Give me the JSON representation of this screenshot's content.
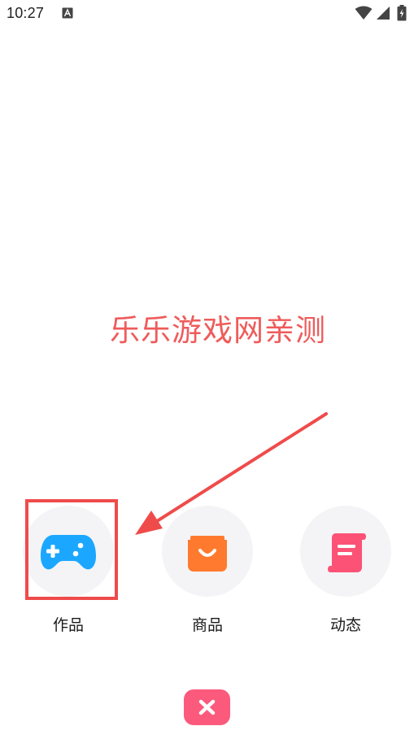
{
  "status_bar": {
    "time": "10:27",
    "notification_icon": "font-icon",
    "wifi_icon": "wifi-icon",
    "signal_icon": "signal-icon",
    "battery_icon": "battery-charging-icon"
  },
  "watermark": {
    "text": "乐乐游戏网亲测",
    "color": "#ef5b5b"
  },
  "menu": {
    "options": [
      {
        "label": "作品",
        "icon": "gamepad-icon",
        "color": "#1ba7ff",
        "highlighted": true
      },
      {
        "label": "商品",
        "icon": "shopping-bag-icon",
        "color": "#ff7a2e",
        "highlighted": false
      },
      {
        "label": "动态",
        "icon": "scroll-icon",
        "color": "#fb5276",
        "highlighted": false
      }
    ]
  },
  "annotation": {
    "arrow_color": "#ef4b4b",
    "box_color": "#ef4b4b"
  },
  "close_button": {
    "icon": "close-icon",
    "color": "#fb5a7c"
  }
}
